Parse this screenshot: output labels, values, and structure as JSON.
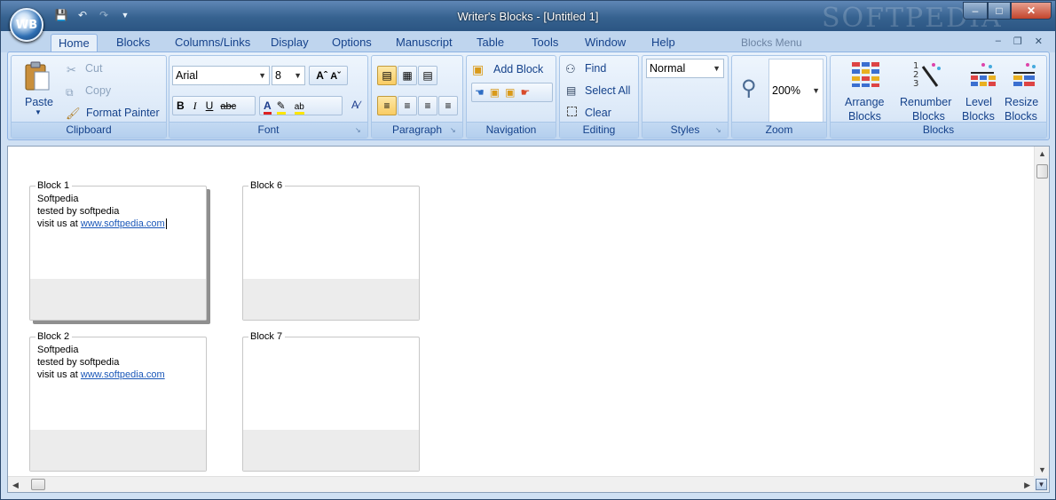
{
  "window": {
    "title": "Writer's Blocks - [Untitled 1]",
    "orb_label": "WB",
    "watermark": "SOFTPEDIA"
  },
  "tabs": [
    {
      "label": "Home",
      "active": true
    },
    {
      "label": "Blocks"
    },
    {
      "label": "Columns/Links"
    },
    {
      "label": "Display"
    },
    {
      "label": "Options"
    },
    {
      "label": "Manuscript"
    },
    {
      "label": "Table"
    },
    {
      "label": "Tools"
    },
    {
      "label": "Window"
    },
    {
      "label": "Help"
    }
  ],
  "blocks_menu_label": "Blocks Menu",
  "ribbon": {
    "clipboard": {
      "label": "Clipboard",
      "paste": "Paste",
      "cut": "Cut",
      "copy": "Copy",
      "format_painter": "Format Painter"
    },
    "font": {
      "label": "Font",
      "family": "Arial",
      "size": "8"
    },
    "paragraph": {
      "label": "Paragraph"
    },
    "navigation": {
      "label": "Navigation",
      "add_block": "Add Block"
    },
    "editing": {
      "label": "Editing",
      "find": "Find",
      "select_all": "Select All",
      "clear": "Clear"
    },
    "styles": {
      "label": "Styles",
      "current": "Normal"
    },
    "zoom": {
      "label": "Zoom",
      "value": "200%"
    },
    "blocks": {
      "label": "Blocks",
      "arrange": [
        "Arrange",
        "Blocks"
      ],
      "renumber": [
        "Renumber",
        "Blocks"
      ],
      "level": [
        "Level",
        "Blocks"
      ],
      "resize": [
        "Resize",
        "Blocks"
      ]
    }
  },
  "document": {
    "blocks": [
      {
        "title": "Block 1",
        "lines": [
          "Softpedia",
          "tested by softpedia"
        ],
        "link_prefix": "visit us at ",
        "link": "www.softpedia.com"
      },
      {
        "title": "Block 2",
        "lines": [
          "Softpedia",
          "tested by softpedia"
        ],
        "link_prefix": "visit us at ",
        "link": "www.softpedia.com"
      },
      {
        "title": "Block 6"
      },
      {
        "title": "Block 7"
      }
    ]
  },
  "colors": {
    "ribbon_text": "#15428b",
    "link": "#1a57b8",
    "title_bar": "#36628f"
  }
}
